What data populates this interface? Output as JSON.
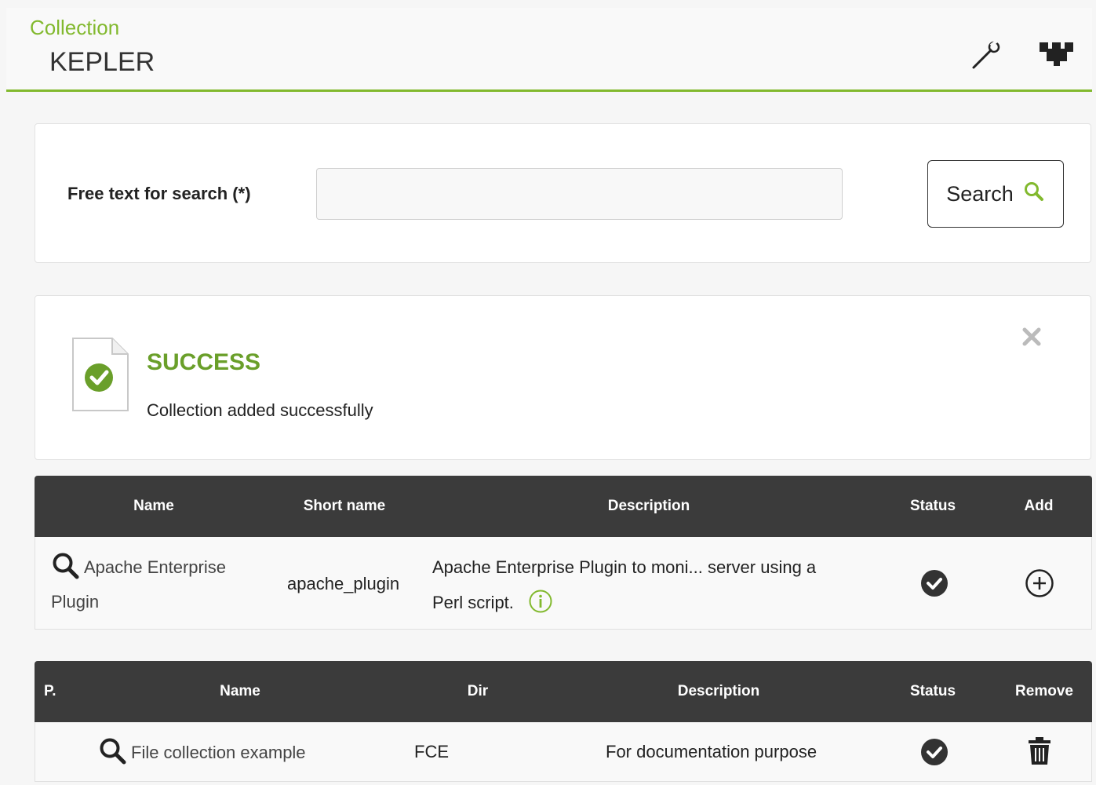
{
  "header": {
    "breadcrumb": "Collection",
    "title": "KEPLER",
    "icons": [
      "wrench-icon",
      "network-icon"
    ]
  },
  "search": {
    "label": "Free text for search (*)",
    "value": "",
    "placeholder": "",
    "button_label": "Search"
  },
  "success": {
    "title": "SUCCESS",
    "message": "Collection added successfully",
    "colors": {
      "accent": "#82b92e",
      "title": "#6a9f2a"
    }
  },
  "available_table": {
    "columns": [
      "Name",
      "Short name",
      "Description",
      "Status",
      "Add"
    ],
    "rows": [
      {
        "name_line1": "Apache Enterprise",
        "name_line2": "Plugin",
        "short_name": "apache_plugin",
        "description_line1": "Apache Enterprise Plugin to moni... server using a",
        "description_line2": "Perl script."
      }
    ]
  },
  "collections_table": {
    "columns": [
      "P.",
      "Name",
      "Dir",
      "Description",
      "Status",
      "Remove"
    ],
    "rows": [
      {
        "name": "File collection example",
        "dir": "FCE",
        "description": "For documentation purpose"
      }
    ]
  }
}
